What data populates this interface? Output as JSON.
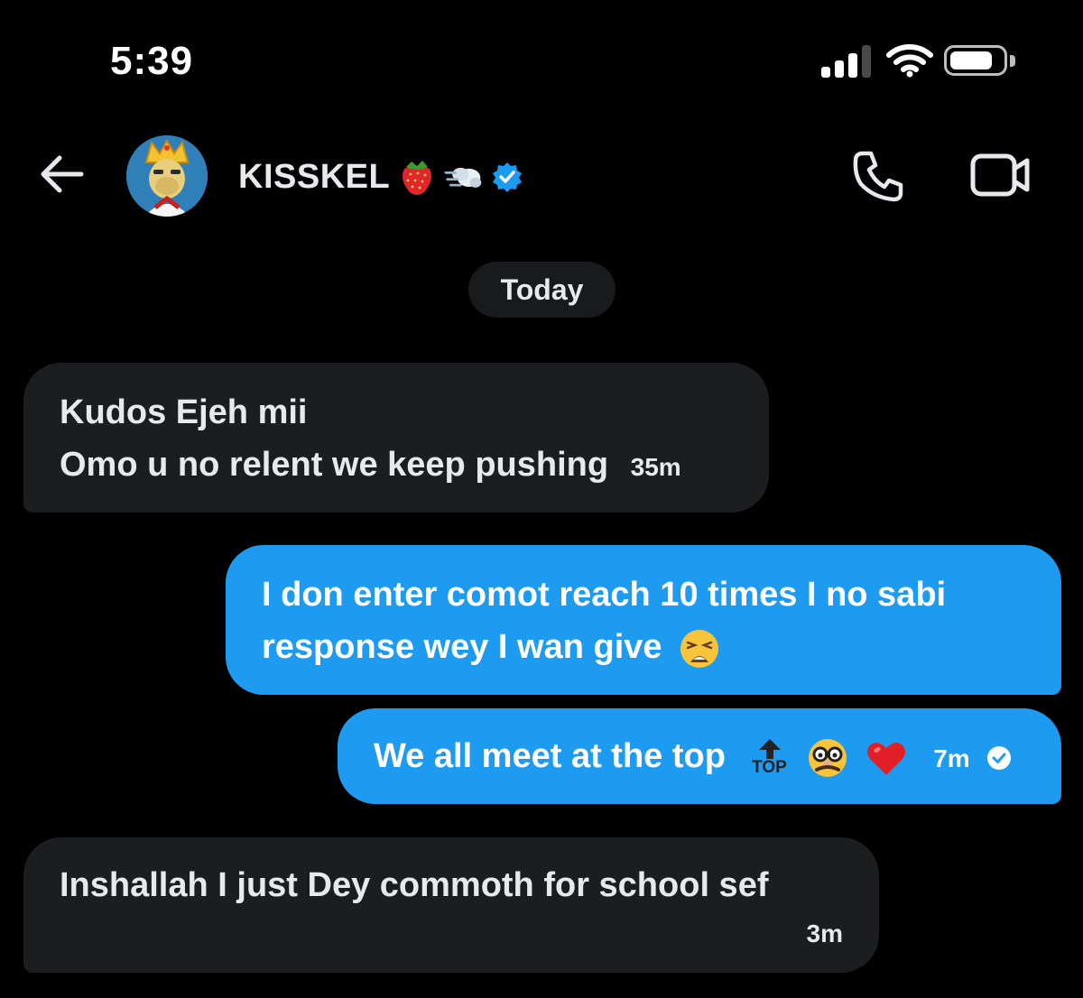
{
  "status_bar": {
    "time": "5:39"
  },
  "header": {
    "contact_name": "KISSKEL",
    "name_emojis": [
      "strawberry-icon",
      "dash-icon"
    ],
    "verified": true,
    "actions": [
      "phone-call-icon",
      "video-call-icon"
    ]
  },
  "date_separator": "Today",
  "messages": [
    {
      "direction": "incoming",
      "lines": [
        "Kudos Ejeh mii",
        "Omo u no relent we keep pushing"
      ],
      "time": "35m"
    },
    {
      "direction": "outgoing",
      "lines": [
        "I don enter comot reach 10 times I no sabi",
        "response wey I wan give"
      ],
      "emoji": "weary-face-icon"
    },
    {
      "direction": "outgoing",
      "text": "We all meet at the top",
      "emoji_text": "TOP",
      "emojis": [
        "top-arrow-icon",
        "disguised-face-icon",
        "red-heart-icon"
      ],
      "time": "7m",
      "seen": true
    },
    {
      "direction": "incoming",
      "text": "Inshallah I just Dey commoth for school sef",
      "time": "3m"
    }
  ],
  "colors": {
    "background": "#000000",
    "incoming_bubble": "#1c1d1f",
    "outgoing_bubble": "#1d9bf0",
    "verified_badge": "#1d9bf0"
  }
}
